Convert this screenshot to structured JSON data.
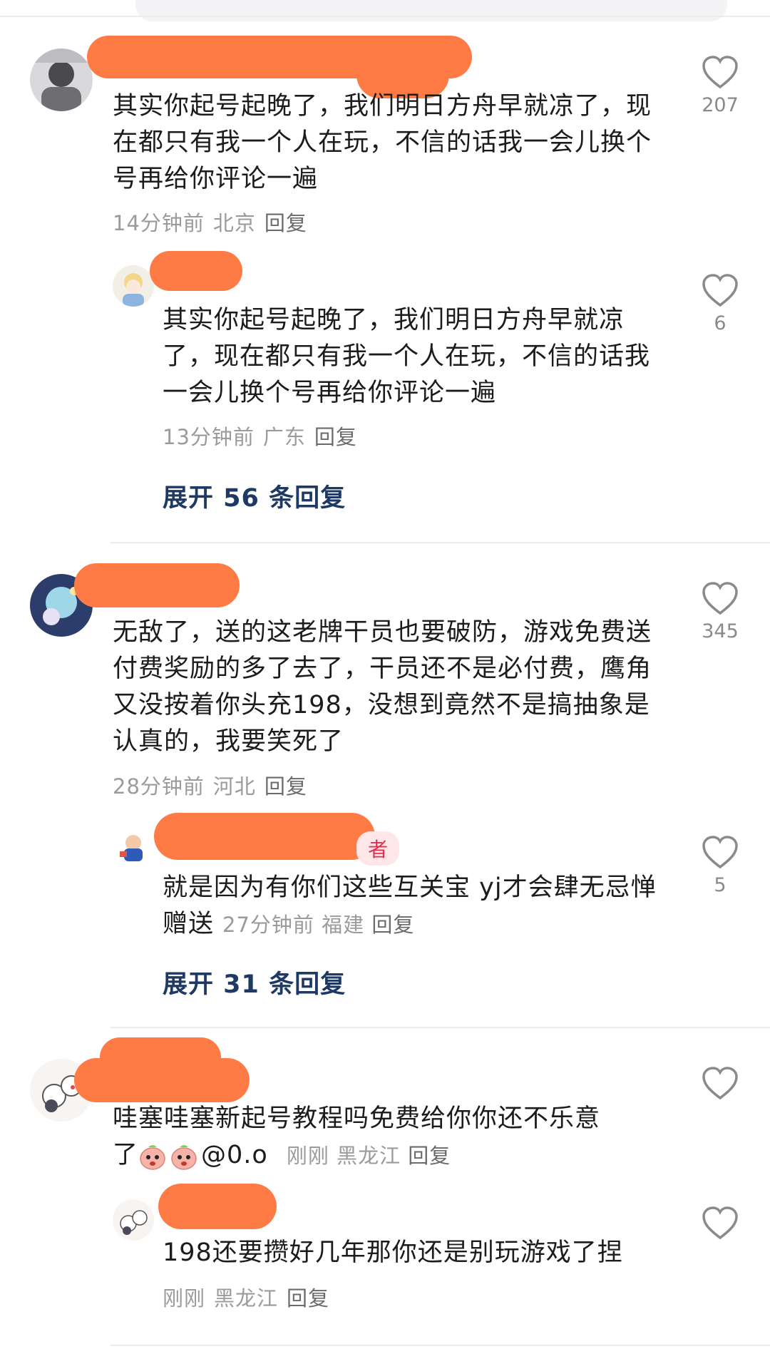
{
  "comments": [
    {
      "text": "其实你起号起晚了，我们明日方舟早就凉了，现在都只有我一个人在玩，不信的话我一会儿换个号再给你评论一遍",
      "time": "14分钟前",
      "location": "北京",
      "reply_label": "回复",
      "likes": "207",
      "reply": {
        "text": "其实你起号起晚了，我们明日方舟早就凉了，现在都只有我一个人在玩，不信的话我一会儿换个号再给你评论一遍",
        "time": "13分钟前",
        "location": "广东",
        "reply_label": "回复",
        "likes": "6"
      },
      "expand": "展开 56 条回复"
    },
    {
      "text": "无敌了，送的这老牌干员也要破防，游戏免费送付费奖励的多了去了，干员还不是必付费，鹰角又没按着你头充198，没想到竟然不是搞抽象是认真的，我要笑死了",
      "time": "28分钟前",
      "location": "河北",
      "reply_label": "回复",
      "likes": "345",
      "reply": {
        "author_tag_fragment": "者",
        "text": "就是因为有你们这些互关宝 yj才会肆无忌惮赠送",
        "time": "27分钟前",
        "location": "福建",
        "reply_label": "回复",
        "likes": "5"
      },
      "expand": "展开 31 条回复"
    },
    {
      "text_line1": "哇塞哇塞新起号教程吗免费给你你还不乐意",
      "text_line2_prefix": "了",
      "mention": "@0.o",
      "time": "刚刚",
      "location": "黑龙江",
      "reply_label": "回复",
      "reply": {
        "text": "198还要攒好几年那你还是别玩游戏了捏",
        "time": "刚刚",
        "location": "黑龙江",
        "reply_label": "回复"
      }
    }
  ]
}
